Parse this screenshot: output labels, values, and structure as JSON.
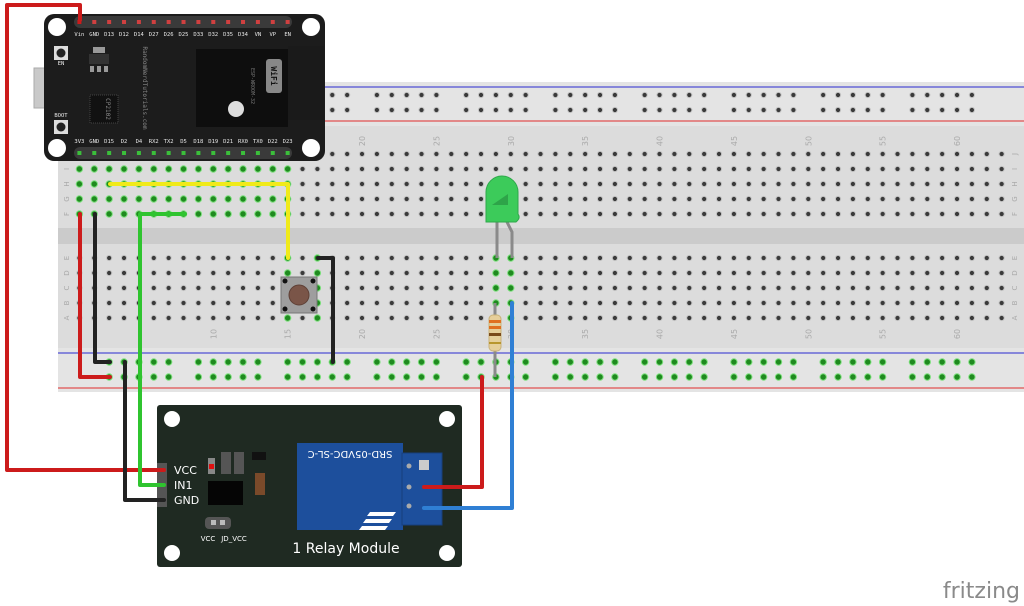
{
  "esp32": {
    "top_pins": [
      "Vin",
      "GND",
      "D13",
      "D12",
      "D14",
      "D27",
      "D26",
      "D25",
      "D33",
      "D32",
      "D35",
      "D34",
      "VN",
      "VP",
      "EN"
    ],
    "bottom_pins": [
      "3V3",
      "GND",
      "D15",
      "D2",
      "D4",
      "RX2",
      "TX2",
      "D5",
      "D18",
      "D19",
      "D21",
      "RX0",
      "TX0",
      "D22",
      "D23"
    ],
    "brand_text": "RandomNerdTutorials.com",
    "chip_text": "CP2102",
    "module_text": "ESP-WROOM-32",
    "wifi_text": "WiFi",
    "en_button": "EN",
    "boot_button": "BOOT"
  },
  "breadboard": {
    "row_letters_top": [
      "J",
      "I",
      "H",
      "G",
      "F"
    ],
    "row_letters_bottom": [
      "E",
      "D",
      "C",
      "B",
      "A"
    ],
    "column_numbers": [
      "10",
      "15",
      "20",
      "25",
      "30",
      "35",
      "40",
      "45",
      "50",
      "55",
      "60"
    ]
  },
  "relay": {
    "pins": [
      "VCC",
      "IN1",
      "GND"
    ],
    "jumper_labels": [
      "VCC",
      "JD_VCC"
    ],
    "relay_part": "SRD-05VDC-SL-C",
    "title": "1 Relay Module"
  },
  "wires": {
    "red": "#cc1b1b",
    "black": "#222222",
    "green": "#2fc42f",
    "yellow": "#f0ea1a",
    "blue": "#2f7fd4"
  },
  "colors": {
    "board_black": "#1c1c1c",
    "relay_pcb": "#1f2a22",
    "relay_blue": "#1d4f9c",
    "led_green": "#3ccb5a",
    "breadboard": "#dcdcdc"
  },
  "logo": {
    "text": "fritzing"
  }
}
